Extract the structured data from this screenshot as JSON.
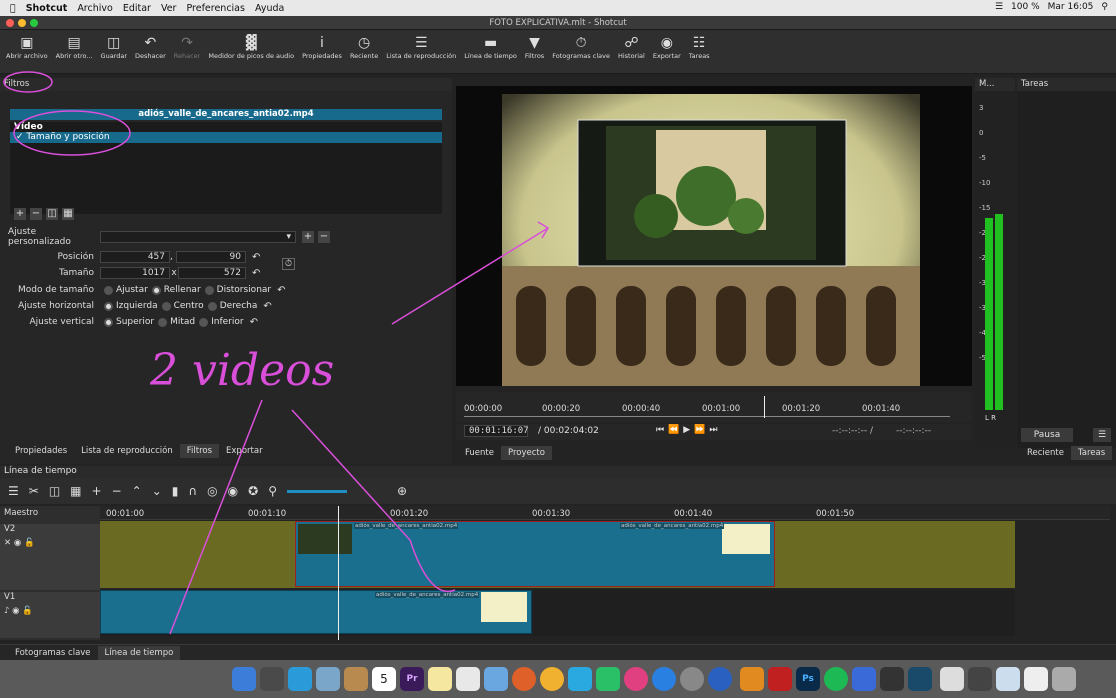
{
  "menubar": {
    "app": "Shotcut",
    "items": [
      "Archivo",
      "Editar",
      "Ver",
      "Preferencias",
      "Ayuda"
    ],
    "status": {
      "battery": "100 %",
      "clock": "Mar 16:05"
    }
  },
  "window": {
    "title": "FOTO EXPLICATIVA.mlt - Shotcut"
  },
  "toolbar": {
    "items": [
      {
        "label": "Abrir archivo",
        "icon": "folder-icon"
      },
      {
        "label": "Abrir otro...",
        "icon": "open-other-icon"
      },
      {
        "label": "Guardar",
        "icon": "save-icon"
      },
      {
        "label": "Deshacer",
        "icon": "undo-icon"
      },
      {
        "label": "Rehacer",
        "icon": "redo-icon"
      },
      {
        "label": "Medidor de picos de audio",
        "icon": "peak-meter-icon"
      },
      {
        "label": "Propiedades",
        "icon": "info-icon"
      },
      {
        "label": "Reciente",
        "icon": "clock-icon"
      },
      {
        "label": "Lista de reproducción",
        "icon": "list-icon"
      },
      {
        "label": "Línea de tiempo",
        "icon": "timeline-icon"
      },
      {
        "label": "Filtros",
        "icon": "filter-icon"
      },
      {
        "label": "Fotogramas clave",
        "icon": "stopwatch-icon"
      },
      {
        "label": "Historial",
        "icon": "history-icon"
      },
      {
        "label": "Exportar",
        "icon": "export-icon"
      },
      {
        "label": "Tareas",
        "icon": "jobs-icon"
      }
    ]
  },
  "filters": {
    "panel_title": "Filtros",
    "clip_name": "adiós_valle_de_ancares_antia02.mp4",
    "category": "Vídeo",
    "filter_item": "Tamaño y posición",
    "preset_label": "Ajuste personalizado",
    "position_label": "Posición",
    "position_x": "457",
    "position_y": "90",
    "size_label": "Tamaño",
    "size_w": "1017",
    "size_sep": "x",
    "size_h": "572",
    "size_mode_label": "Modo de tamaño",
    "size_mode_options": [
      "Ajustar",
      "Rellenar",
      "Distorsionar"
    ],
    "h_align_label": "Ajuste horizontal",
    "h_align_options": [
      "Izquierda",
      "Centro",
      "Derecha"
    ],
    "v_align_label": "Ajuste vertical",
    "v_align_options": [
      "Superior",
      "Mitad",
      "Inferior"
    ]
  },
  "left_tabs": [
    "Propiedades",
    "Lista de reproducción",
    "Filtros",
    "Exportar"
  ],
  "viewer": {
    "ruler": [
      "00:00:00",
      "00:00:20",
      "00:00:40",
      "00:01:00",
      "00:01:20",
      "00:01:40"
    ],
    "timecode": "00:01:16:07",
    "duration": "/ 00:02:04:02",
    "in_point": "--:--:--:-- /",
    "out_point": "--:--:--:--",
    "tabs": [
      "Fuente",
      "Proyecto"
    ]
  },
  "meter": {
    "title": "M...",
    "scale": [
      "3",
      "0",
      "-5",
      "-10",
      "-15",
      "-20",
      "-25",
      "-30",
      "-35",
      "-40",
      "-50"
    ],
    "channels": "L R"
  },
  "jobs": {
    "title": "Tareas",
    "pause": "Pausa",
    "tabs": [
      "Reciente",
      "Tareas"
    ]
  },
  "timeline": {
    "title": "Línea de tiempo",
    "master": "Maestro",
    "ruler": [
      "00:01:00",
      "00:01:10",
      "00:01:20",
      "00:01:30",
      "00:01:40",
      "00:01:50"
    ],
    "tracks": [
      "V2",
      "V1"
    ],
    "clip_label": "adiós_valle_de_ancares_antia02.mp4"
  },
  "bottom_tabs": [
    "Fotogramas clave",
    "Línea de tiempo"
  ],
  "annotation": {
    "text": "2 videos",
    "color": "#d94fd9"
  },
  "dock": {
    "calendar_day": "5"
  }
}
